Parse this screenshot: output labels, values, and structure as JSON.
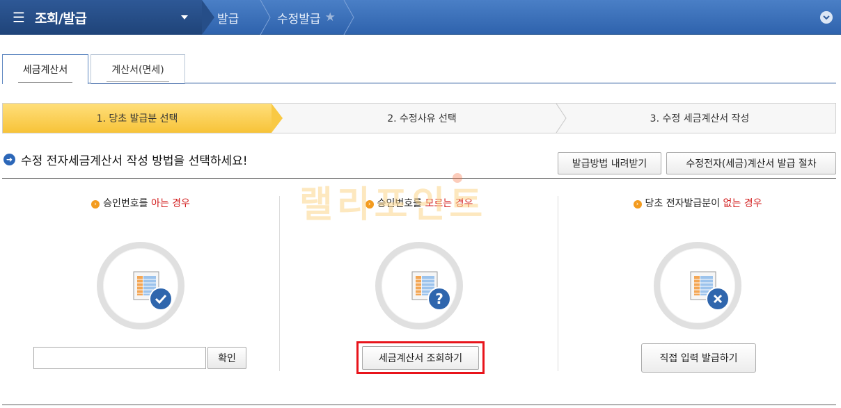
{
  "nav": {
    "main_label": "조회/발급",
    "crumbs": [
      {
        "label": "발급"
      },
      {
        "label": "수정발급"
      }
    ]
  },
  "tabs": [
    {
      "label": "세금계산서",
      "active": true
    },
    {
      "label": "계산서(면세)",
      "active": false
    }
  ],
  "steps": [
    {
      "label": "1. 당초 발급분 선택",
      "active": true
    },
    {
      "label": "2. 수정사유 선택",
      "active": false
    },
    {
      "label": "3. 수정 세금계산서 작성",
      "active": false
    }
  ],
  "section": {
    "heading": "수정 전자세금계산서 작성 방법을 선택하세요!",
    "download_button": "발급방법 내려받기",
    "procedure_button": "수정전자(세금)계산서 발급 절차"
  },
  "columns": [
    {
      "head_prefix": "승인번호를 ",
      "head_emphasis": "아는 경우",
      "head_suffix": "",
      "badge": "check-icon",
      "input_value": "",
      "button_label": "확인"
    },
    {
      "head_prefix": "승인번호를 ",
      "head_emphasis": "모르는 경우",
      "head_suffix": "",
      "badge": "question-icon",
      "button_label": "세금계산서 조회하기"
    },
    {
      "head_prefix": "당초 전자발급분이 ",
      "head_emphasis": "없는 경우",
      "head_suffix": "",
      "badge": "x-icon",
      "button_label": "직접 입력 발급하기"
    }
  ],
  "watermark": "랠리포인트",
  "colors": {
    "nav_blue": "#2f63ad",
    "step_active": "#f7c338",
    "emphasis_red": "#d21d1d",
    "highlight_border": "#e8141b",
    "badge_blue": "#2f66ad"
  }
}
